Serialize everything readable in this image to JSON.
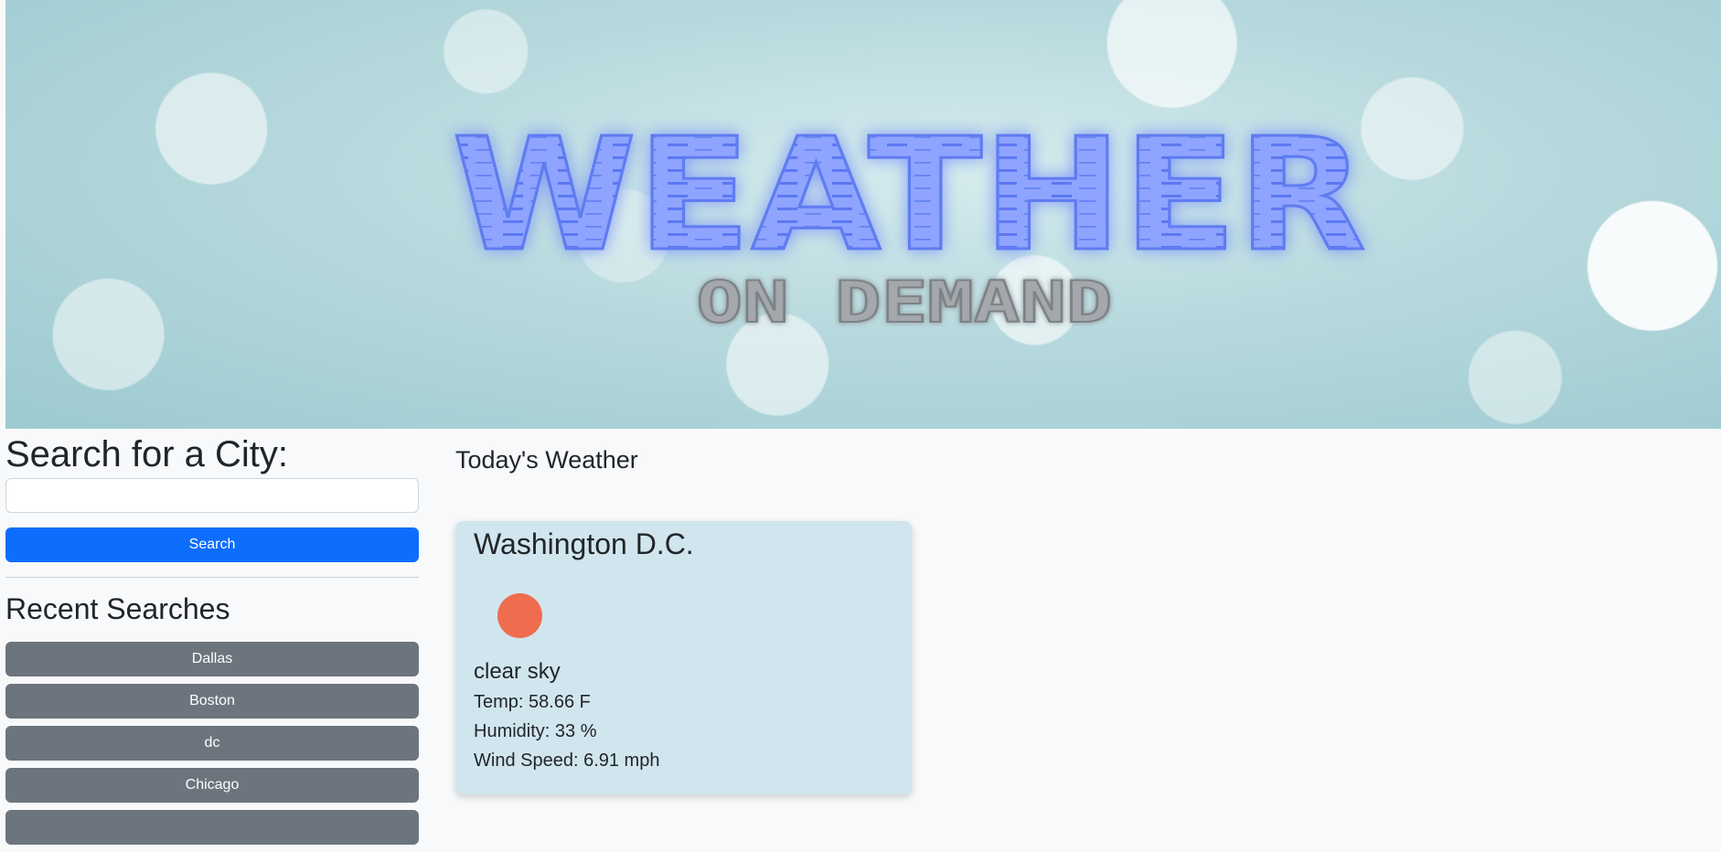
{
  "banner": {
    "title": "WEATHER",
    "subtitle": "ON DEMAND"
  },
  "search": {
    "heading": "Search for a City:",
    "input_value": "",
    "input_placeholder": "",
    "button_label": "Search"
  },
  "recent": {
    "heading": "Recent Searches",
    "items": [
      {
        "label": "Dallas"
      },
      {
        "label": "Boston"
      },
      {
        "label": "dc"
      },
      {
        "label": "Chicago"
      }
    ]
  },
  "today": {
    "heading": "Today's Weather",
    "city": "Washington D.C.",
    "icon": "sun-icon",
    "description": "clear sky",
    "temp": "Temp: 58.66 F",
    "humidity": "Humidity: 33 %",
    "wind": "Wind Speed: 6.91 mph"
  },
  "colors": {
    "primary": "#0d6efd",
    "secondary": "#6c757d",
    "card": "#d1e5ee",
    "sun": "#ef6d4e",
    "title_blue": "#8ea4ff"
  }
}
